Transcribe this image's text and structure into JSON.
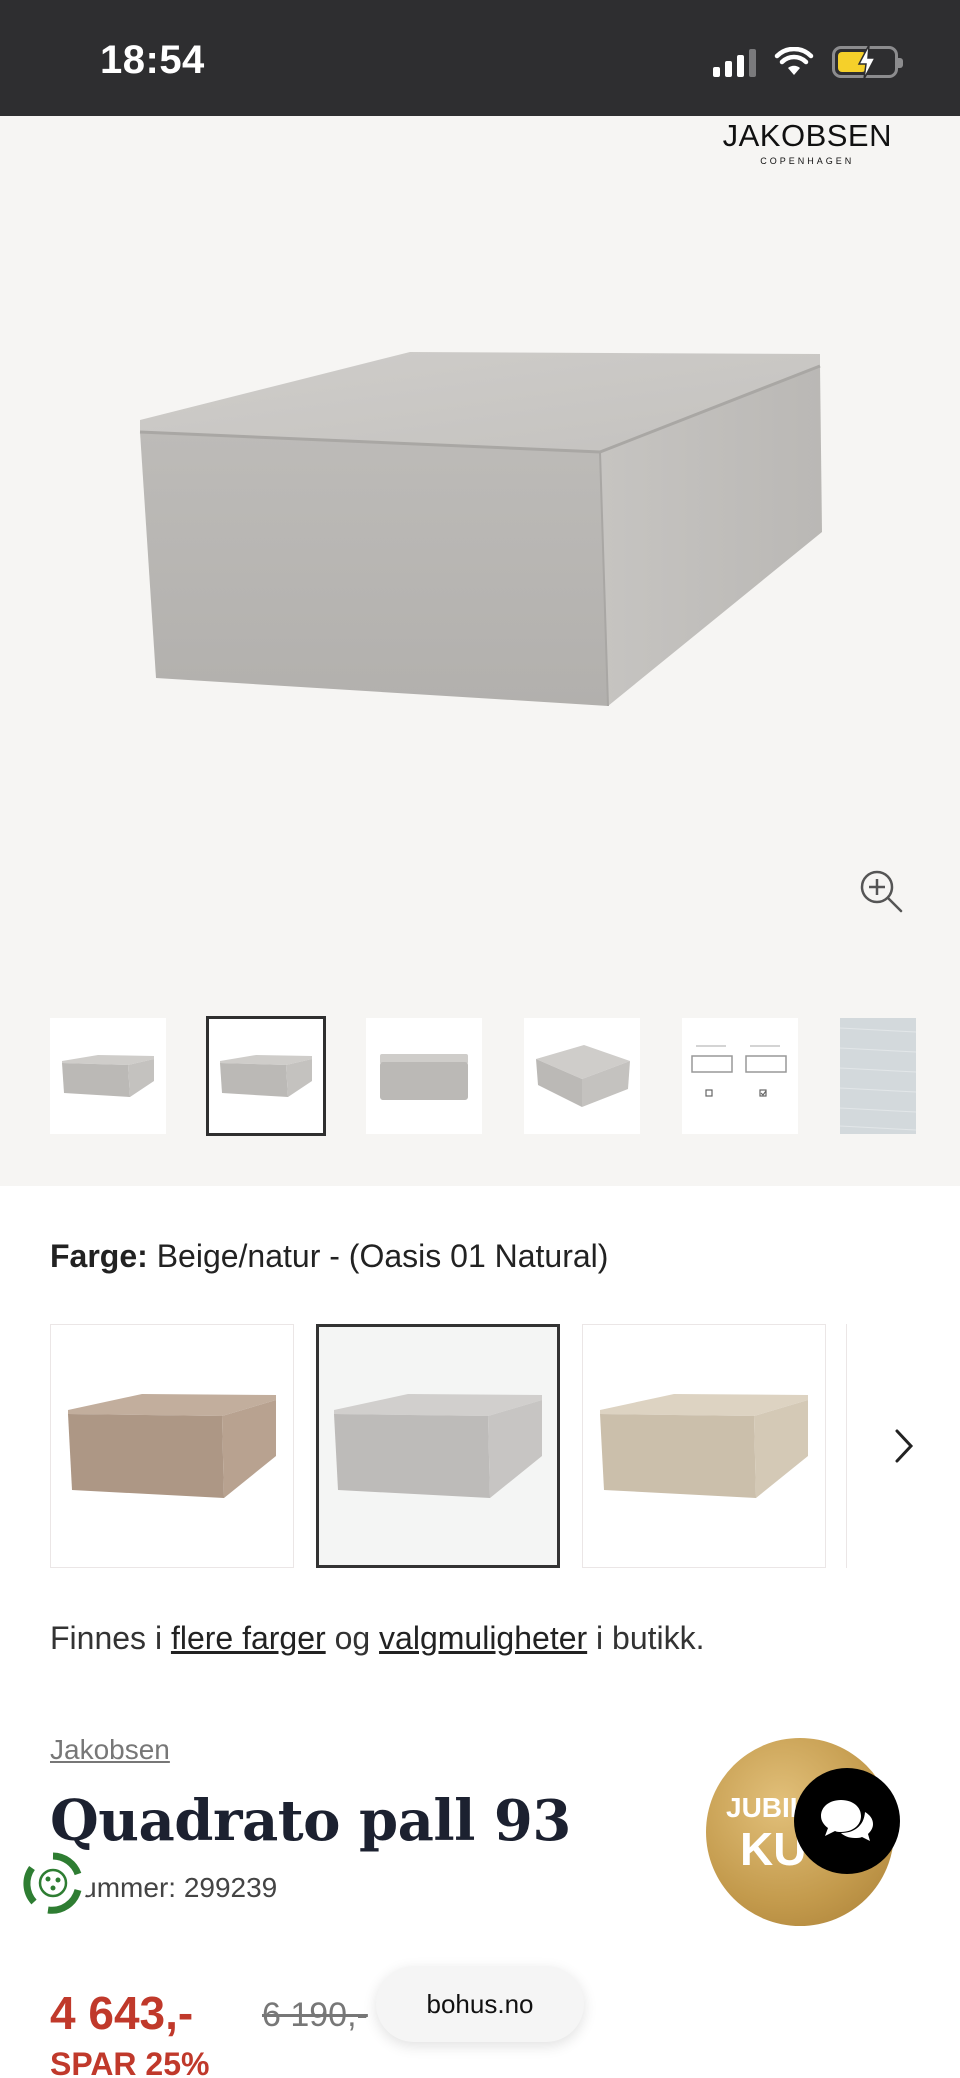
{
  "status_bar": {
    "time": "18:54",
    "icons": [
      "signal-icon",
      "wifi-icon",
      "battery-charging-icon"
    ]
  },
  "gallery": {
    "brand_logo": {
      "name": "JAKOBSEN",
      "sub": "COPENHAGEN"
    },
    "zoom_icon": "zoom-in-icon",
    "thumbnails": [
      {
        "kind": "ottoman-front",
        "active": false
      },
      {
        "kind": "ottoman-angle",
        "active": true
      },
      {
        "kind": "ottoman-side",
        "active": false
      },
      {
        "kind": "ottoman-top",
        "active": false
      },
      {
        "kind": "config-diagram",
        "active": false
      },
      {
        "kind": "fabric-swatch",
        "active": false
      }
    ]
  },
  "color_section": {
    "label": "Farge:",
    "value": "Beige/natur - (Oasis 01 Natural)",
    "swatches": [
      {
        "color": "#b39f8e",
        "active": false
      },
      {
        "color": "#c8c6c4",
        "active": true
      },
      {
        "color": "#d6cbb7",
        "active": false
      }
    ],
    "next_icon": "chevron-right-icon"
  },
  "availability": {
    "prefix": "Finnes i",
    "link1": "flere farger",
    "middle": "og",
    "link2": "valgmuligheter",
    "suffix": "i butikk."
  },
  "product": {
    "brand": "Jakobsen",
    "title": "Quadrato pall 93",
    "article_number": "enummer: 299239",
    "price": "4 643,-",
    "old_price": "6 190,-",
    "saving": "SPAR 25%"
  },
  "jubilee_badge": {
    "line1": "JUBIL",
    "line2": "KU"
  },
  "chat_button": {
    "icon": "chat-bubbles-icon"
  },
  "eco_badge": {
    "icon": "recycle-icon"
  },
  "url_bar": {
    "domain": "bohus.no"
  }
}
